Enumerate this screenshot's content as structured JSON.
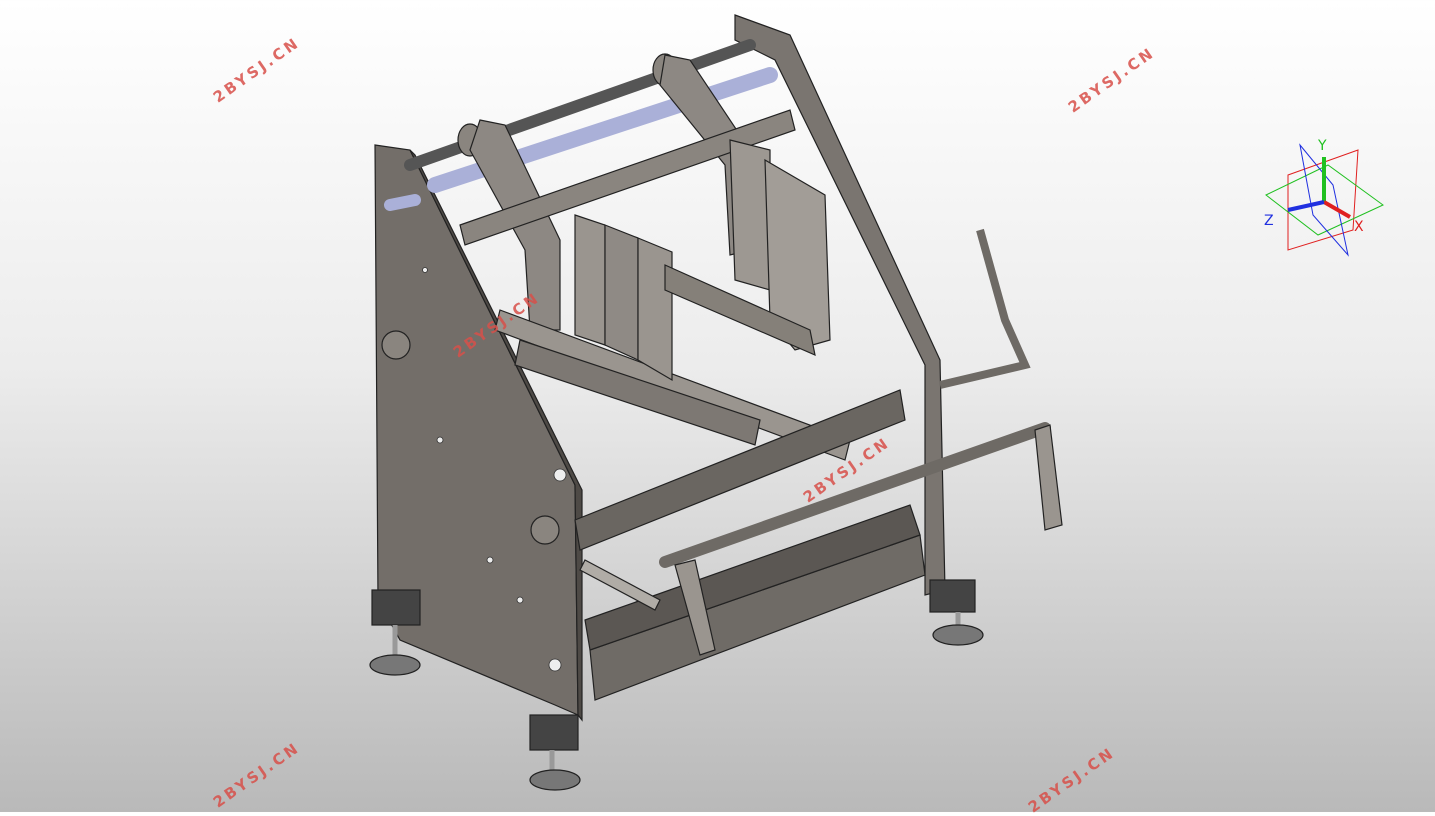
{
  "watermarks": [
    "2BYSJ.CN",
    "2BYSJ.CN",
    "2BYSJ.CN",
    "2BYSJ.CN",
    "2BYSJ.CN",
    "2BYSJ.CN"
  ],
  "triad": {
    "x_label": "X",
    "y_label": "Y",
    "z_label": "Z",
    "x_color": "#e02020",
    "y_color": "#20c020",
    "z_color": "#2030e0"
  },
  "colors": {
    "frame": "#6f6b66",
    "frame_dark": "#4e4a46",
    "rod_blue": "#aab0d8",
    "part_light": "#9a958f"
  }
}
